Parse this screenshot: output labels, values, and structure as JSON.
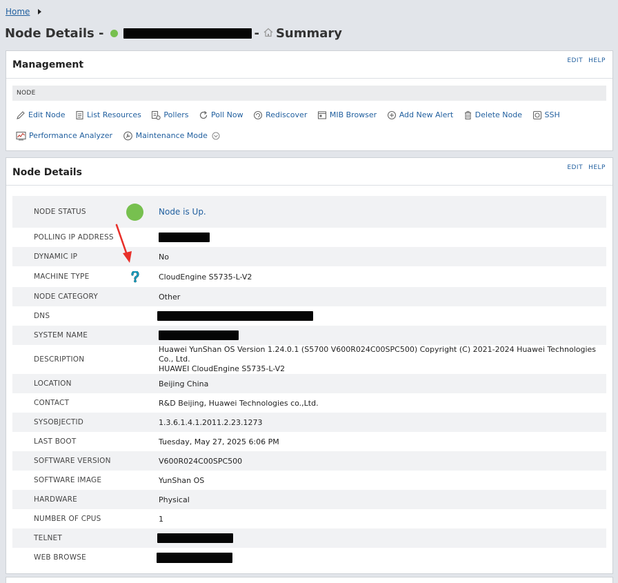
{
  "breadcrumb": {
    "home": "Home"
  },
  "page": {
    "title_prefix": "Node Details -",
    "title_sep": "-",
    "section": "Summary"
  },
  "colors": {
    "status_up": "#77c04f",
    "link": "#1f5e9e",
    "arrow": "#e8302a",
    "help_icon": "#19a5c8"
  },
  "management": {
    "title": "Management",
    "edit": "EDIT",
    "help": "HELP",
    "section_label": "NODE",
    "tools": [
      {
        "label": "Edit Node",
        "icon": "pencil-icon"
      },
      {
        "label": "List Resources",
        "icon": "document-icon"
      },
      {
        "label": "Pollers",
        "icon": "pollers-icon"
      },
      {
        "label": "Poll Now",
        "icon": "refresh-icon"
      },
      {
        "label": "Rediscover",
        "icon": "rediscover-icon"
      },
      {
        "label": "MIB Browser",
        "icon": "mib-browser-icon"
      },
      {
        "label": "Add New Alert",
        "icon": "plus-circle-icon"
      },
      {
        "label": "Delete Node",
        "icon": "trash-icon"
      },
      {
        "label": "SSH",
        "icon": "ssh-icon"
      },
      {
        "label": "Performance Analyzer",
        "icon": "performance-icon"
      },
      {
        "label": "Maintenance Mode",
        "icon": "maintenance-icon"
      }
    ]
  },
  "node_details": {
    "title": "Node Details",
    "edit": "EDIT",
    "help": "HELP",
    "rows": [
      {
        "label": "NODE STATUS",
        "value": "Node is Up."
      },
      {
        "label": "POLLING IP ADDRESS",
        "value": ""
      },
      {
        "label": "DYNAMIC IP",
        "value": "No"
      },
      {
        "label": "MACHINE TYPE",
        "value": "CloudEngine S5735-L-V2"
      },
      {
        "label": "NODE CATEGORY",
        "value": "Other"
      },
      {
        "label": "DNS",
        "value": ""
      },
      {
        "label": "SYSTEM NAME",
        "value": ""
      },
      {
        "label": "DESCRIPTION",
        "value": "Huawei YunShan OS Version 1.24.0.1 (S5700 V600R024C00SPC500) Copyright (C) 2021-2024 Huawei Technologies Co., Ltd.",
        "value2": "HUAWEI CloudEngine S5735-L-V2"
      },
      {
        "label": "LOCATION",
        "value": "Beijing China"
      },
      {
        "label": "CONTACT",
        "value": "R&D Beijing, Huawei Technologies co.,Ltd."
      },
      {
        "label": "SYSOBJECTID",
        "value": "1.3.6.1.4.1.2011.2.23.1273"
      },
      {
        "label": "LAST BOOT",
        "value": "Tuesday, May 27, 2025 6:06 PM"
      },
      {
        "label": "SOFTWARE VERSION",
        "value": "V600R024C00SPC500"
      },
      {
        "label": "SOFTWARE IMAGE",
        "value": "YunShan OS"
      },
      {
        "label": "HARDWARE",
        "value": "Physical"
      },
      {
        "label": "NUMBER OF CPUS",
        "value": "1"
      },
      {
        "label": "TELNET",
        "value": ""
      },
      {
        "label": "WEB BROWSE",
        "value": ""
      }
    ]
  }
}
